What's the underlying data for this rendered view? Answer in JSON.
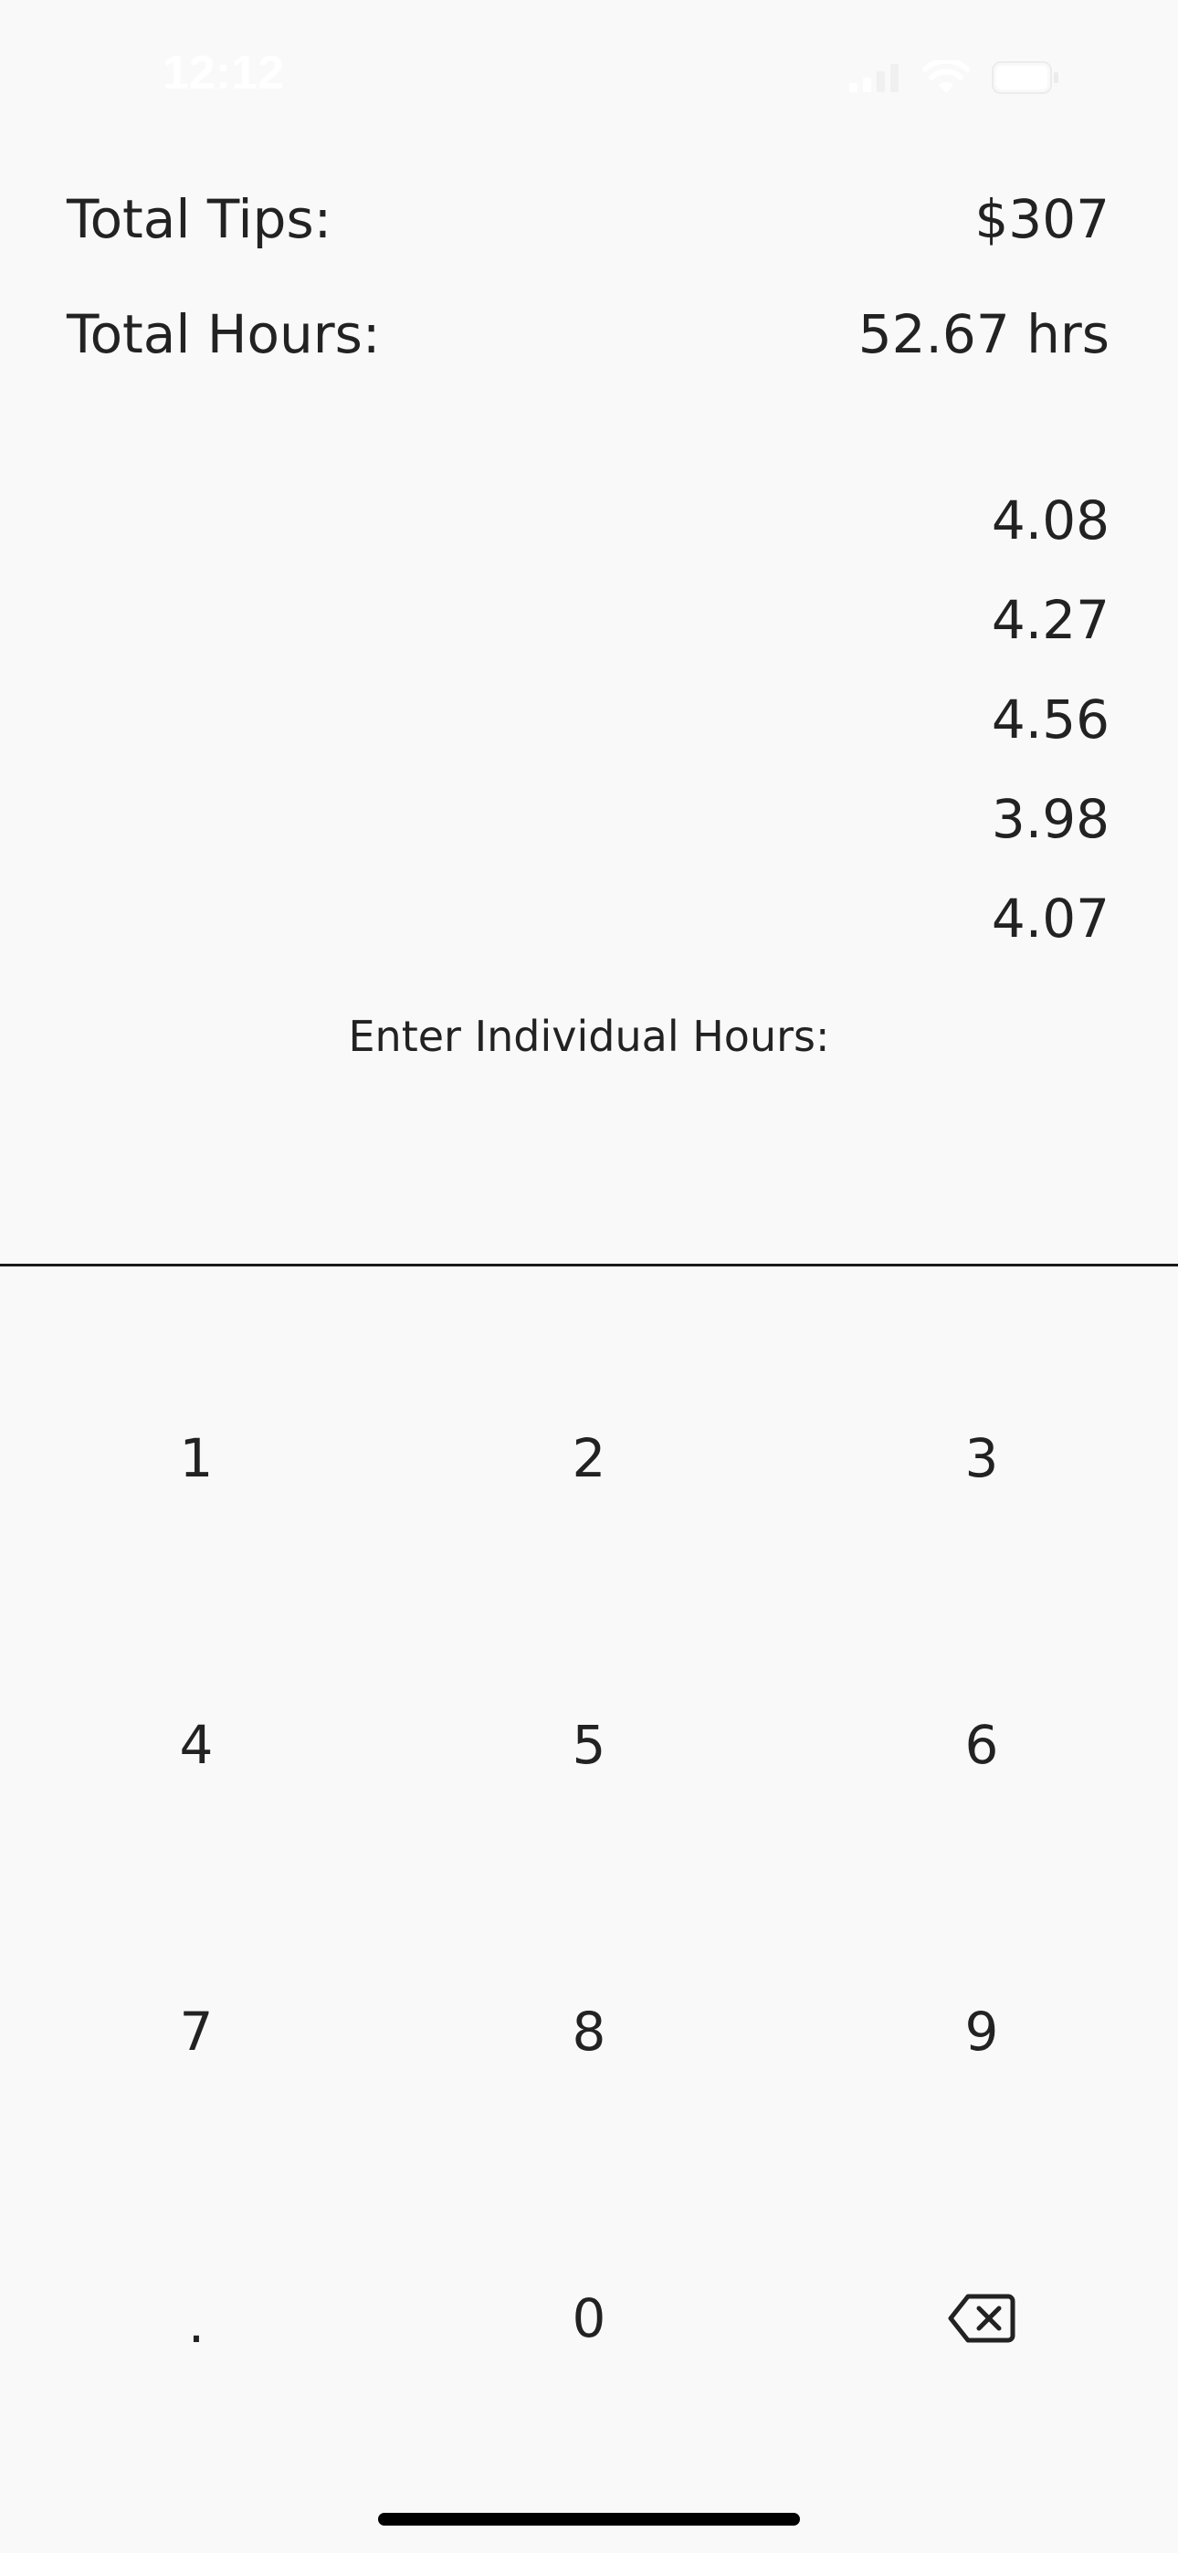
{
  "status_bar": {
    "time": "12:12"
  },
  "summary": {
    "tips_label": "Total Tips:",
    "tips_value": "$307",
    "hours_label": "Total Hours:",
    "hours_value": "52.67 hrs"
  },
  "individual_hours": [
    "4.08",
    "4.27",
    "4.56",
    "3.98",
    "4.07"
  ],
  "input": {
    "prompt": "Enter Individual Hours:"
  },
  "keypad": {
    "keys": [
      "1",
      "2",
      "3",
      "4",
      "5",
      "6",
      "7",
      "8",
      "9",
      ".",
      "0"
    ],
    "backspace_icon": "backspace-icon"
  }
}
